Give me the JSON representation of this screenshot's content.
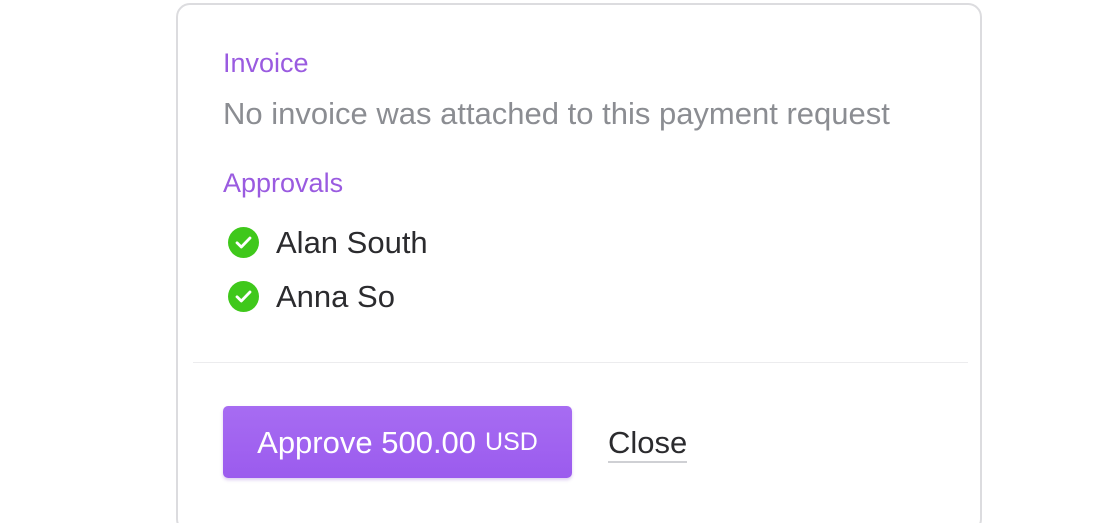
{
  "invoice": {
    "label": "Invoice",
    "text": "No invoice was attached to this payment request"
  },
  "approvals": {
    "label": "Approvals",
    "items": [
      {
        "name": "Alan South",
        "status": "approved",
        "icon": "check-circle-icon"
      },
      {
        "name": "Anna So",
        "status": "approved",
        "icon": "check-circle-icon"
      }
    ]
  },
  "actions": {
    "approve_label": "Approve 500.00",
    "approve_currency": "USD",
    "close_label": "Close"
  },
  "colors": {
    "accent": "#9a5be0",
    "approve_button": "#a36af1",
    "check": "#3fc81b",
    "muted_text": "#8b8d92"
  }
}
